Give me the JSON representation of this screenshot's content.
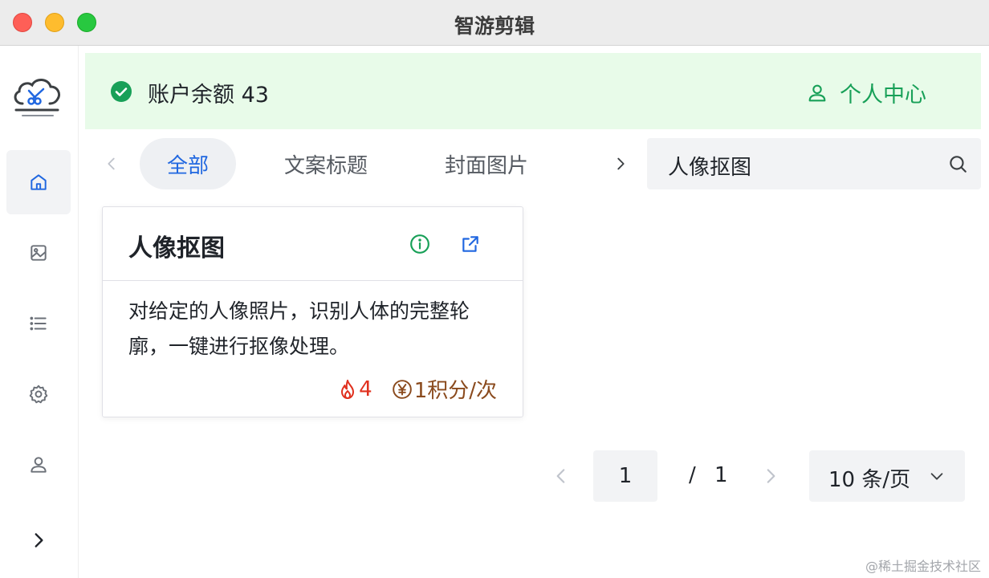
{
  "window": {
    "title": "智游剪辑"
  },
  "sidebar": {
    "logo": "cloud-scissors-logo",
    "items": [
      {
        "icon": "home-icon",
        "active": true
      },
      {
        "icon": "image-icon",
        "active": false
      },
      {
        "icon": "list-icon",
        "active": false
      },
      {
        "icon": "gear-icon",
        "active": false
      },
      {
        "icon": "user-icon",
        "active": false
      },
      {
        "icon": "chevron-right-icon",
        "active": false
      }
    ]
  },
  "banner": {
    "balance_text": "账户余额 43",
    "user_center_label": "个人中心",
    "accent_color": "#18a058",
    "background": "#e8fbe9"
  },
  "tabs": {
    "items": [
      {
        "label": "全部",
        "active": true
      },
      {
        "label": "文案标题",
        "active": false
      },
      {
        "label": "封面图片",
        "active": false
      }
    ],
    "active_color": "#2067e0"
  },
  "search": {
    "value": "人像抠图"
  },
  "card": {
    "title": "人像抠图",
    "description": "对给定的人像照片，识别人体的完整轮廓，一键进行抠像处理。",
    "hot_count": "4",
    "price_text": "1积分/次"
  },
  "pagination": {
    "current_page": "1",
    "slash": "/",
    "total_pages": "1",
    "page_size_label": "10 条/页"
  },
  "watermark": "@稀土掘金技术社区"
}
